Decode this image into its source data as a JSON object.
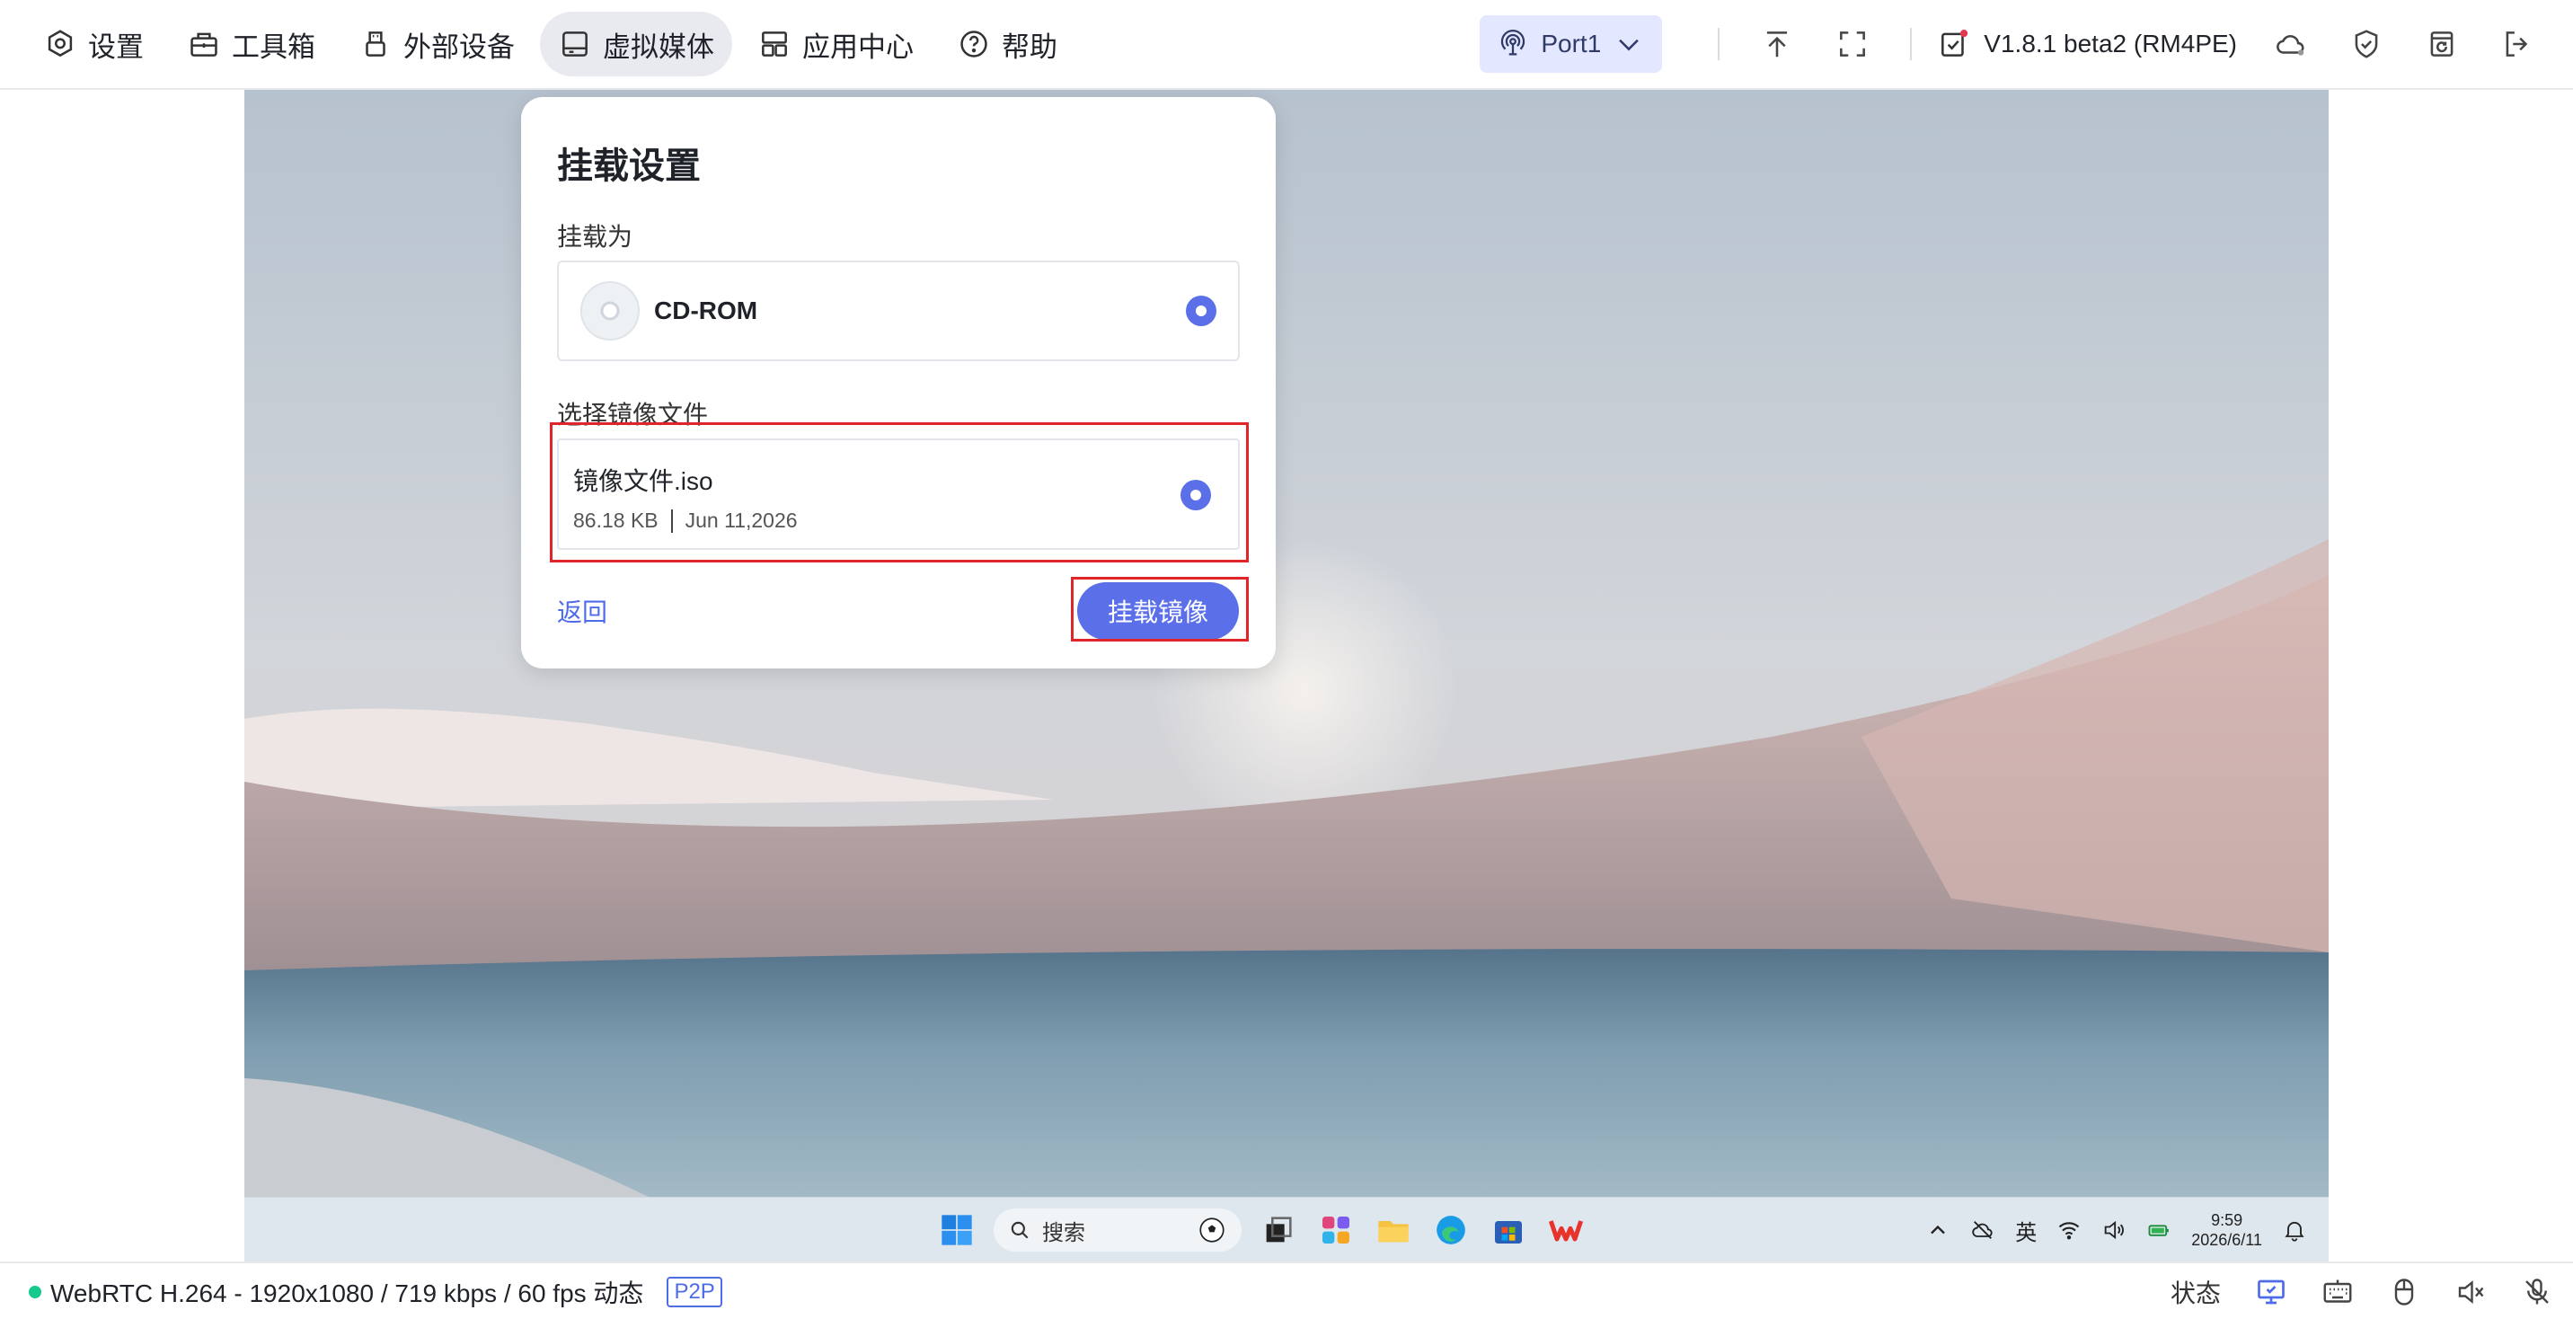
{
  "toolbar": {
    "nav": [
      {
        "label": "设置",
        "icon": "gear-icon"
      },
      {
        "label": "工具箱",
        "icon": "toolbox-icon"
      },
      {
        "label": "外部设备",
        "icon": "usb-icon"
      },
      {
        "label": "虚拟媒体",
        "icon": "disk-icon",
        "active": true
      },
      {
        "label": "应用中心",
        "icon": "apps-icon"
      },
      {
        "label": "帮助",
        "icon": "help-icon"
      }
    ],
    "port": "Port1",
    "version": "V1.8.1 beta2 (RM4PE)"
  },
  "dialog": {
    "title": "挂载设置",
    "mount_as_label": "挂载为",
    "mount_option": "CD-ROM",
    "select_file_label": "选择镜像文件",
    "file": {
      "name": "镜像文件.iso",
      "size": "86.18 KB",
      "date": "Jun 11,2026"
    },
    "back_label": "返回",
    "mount_button": "挂载镜像"
  },
  "taskbar": {
    "search_placeholder": "搜索",
    "ime": "英",
    "time": "9:59",
    "date": "2026/6/11"
  },
  "status": {
    "stream": "WebRTC H.264 - 1920x1080 / 719 kbps / 60 fps 动态",
    "mode": "P2P",
    "state_label": "状态",
    "connected_color": "#16c98d"
  },
  "colors": {
    "accent": "#5b70e8",
    "highlight": "#e0252a"
  }
}
